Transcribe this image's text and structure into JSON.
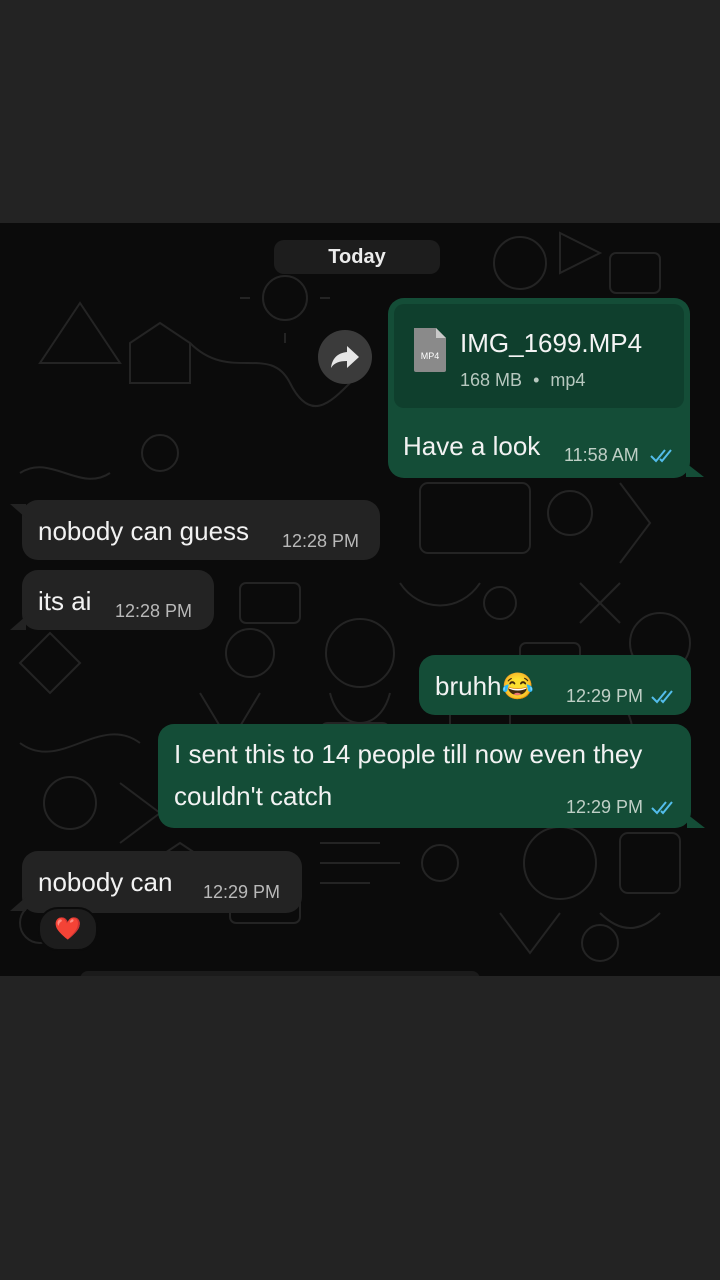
{
  "chat": {
    "date_divider": "Today",
    "colors": {
      "background": "#0b0b0b",
      "incoming_bubble": "#232323",
      "outgoing_bubble": "#144d37",
      "read_ticks": "#53bdeb"
    },
    "messages": [
      {
        "direction": "outgoing",
        "type": "file",
        "file": {
          "icon_label": "MP4",
          "name": "IMG_1699.MP4",
          "size": "168 MB",
          "separator": "•",
          "ext": "mp4"
        },
        "text": "Have a look",
        "time": "11:58 AM",
        "status": "read"
      },
      {
        "direction": "incoming",
        "text": "nobody can guess",
        "time": "12:28 PM"
      },
      {
        "direction": "incoming",
        "text": "its ai",
        "time": "12:28 PM"
      },
      {
        "direction": "outgoing",
        "text": "bruhh😂",
        "time": "12:29 PM",
        "status": "read"
      },
      {
        "direction": "outgoing",
        "text_line1": "I sent this to 14 people till now even they",
        "text_line2": "couldn't catch",
        "time": "12:29 PM",
        "status": "read"
      },
      {
        "direction": "incoming",
        "text": "nobody can",
        "time": "12:29 PM",
        "reaction": "❤️"
      }
    ]
  }
}
